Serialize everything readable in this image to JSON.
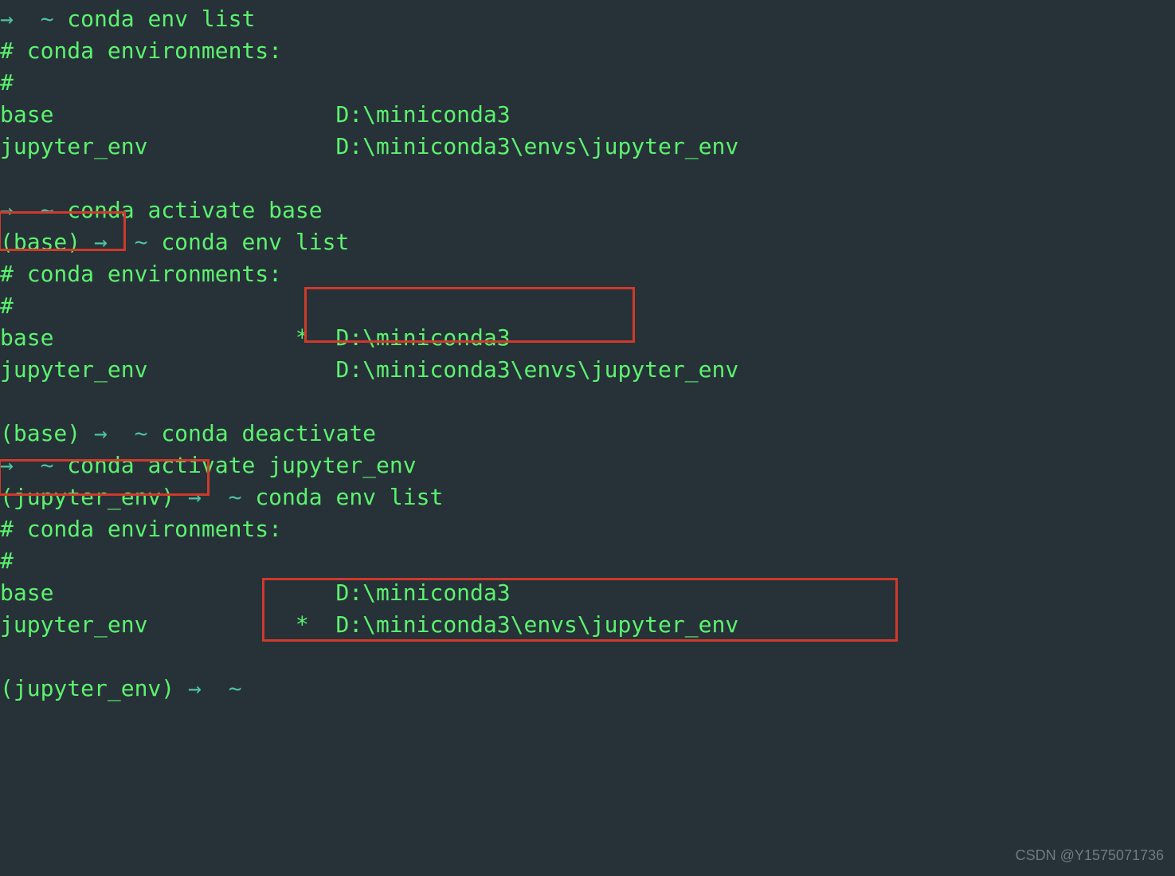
{
  "glyphs": {
    "arrow": "→",
    "tilde": "~"
  },
  "prompts": {
    "base": "(base)",
    "jupyter": "(jupyter_env)"
  },
  "cmds": {
    "env_list": "conda env list",
    "act_base": "conda activate base",
    "deact": "conda deactivate",
    "act_jup": "conda activate jupyter_env"
  },
  "outputs": {
    "header": "# conda environments:",
    "hash": "#",
    "col_name_base": "base",
    "col_name_jup": "jupyter_env",
    "star": "*",
    "path_base": "D:\\miniconda3",
    "path_jup": "D:\\miniconda3\\envs\\jupyter_env"
  },
  "watermark": "CSDN @Y1575071736"
}
